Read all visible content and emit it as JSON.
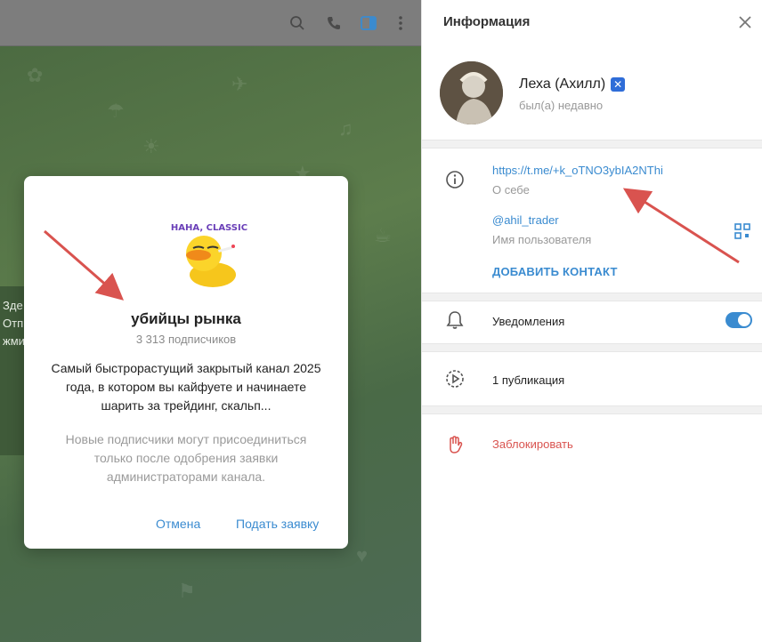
{
  "chat": {
    "fragment_lines": [
      "Зде",
      "Отпр",
      "жми"
    ]
  },
  "modal": {
    "sticker_text": "HAHA, CLASSIC",
    "title": "убийцы рынка",
    "subscribers": "3 313 подписчиков",
    "description": "Самый быстрорастущий закрытый канал 2025 года, в котором вы кайфуете и начинаете шарить за трейдинг, скальп...",
    "approval_note": "Новые подписчики могут присоединиться только после одобрения заявки администраторами канала.",
    "cancel_label": "Отмена",
    "apply_label": "Подать заявку"
  },
  "info": {
    "title": "Информация",
    "user_name": "Леха (Ахилл)",
    "badge_icon": "x-badge-icon",
    "last_seen": "был(а) недавно",
    "bio_link": "https://t.me/+k_oTNO3ybIA2NThi",
    "bio_label": "О себе",
    "username": "@ahil_trader",
    "username_label": "Имя пользователя",
    "add_contact": "ДОБАВИТЬ КОНТАКТ",
    "notifications_label": "Уведомления",
    "notifications_on": true,
    "publications_label": "1 публикация",
    "block_label": "Заблокировать"
  },
  "colors": {
    "accent": "#3a8bd0",
    "danger": "#d9534f",
    "annotation_arrow": "#d9534f"
  }
}
